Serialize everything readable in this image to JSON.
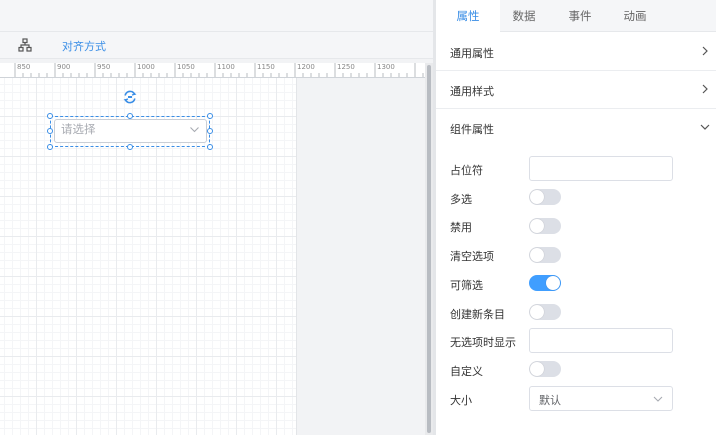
{
  "toolbar": {
    "tree_icon": "hierarchy-icon",
    "align_label": "对齐方式"
  },
  "ruler": {
    "labels": [
      "850",
      "900",
      "950",
      "1000",
      "1050",
      "1100",
      "1150",
      "1200",
      "1250",
      "1300"
    ]
  },
  "canvas_component": {
    "placeholder": "请选择",
    "rotate_icon": "rotate-icon",
    "chevron_icon": "chevron-down-icon"
  },
  "panel": {
    "tabs": [
      {
        "label": "属性",
        "active": true
      },
      {
        "label": "数据",
        "active": false
      },
      {
        "label": "事件",
        "active": false
      },
      {
        "label": "动画",
        "active": false
      }
    ],
    "sections": [
      {
        "title": "通用属性",
        "expanded": false
      },
      {
        "title": "通用样式",
        "expanded": false
      },
      {
        "title": "组件属性",
        "expanded": true
      }
    ],
    "props": {
      "placeholder": {
        "label": "占位符",
        "value": ""
      },
      "multiple": {
        "label": "多选",
        "on": false
      },
      "disabled": {
        "label": "禁用",
        "on": false
      },
      "clearable": {
        "label": "清空选项",
        "on": false
      },
      "filterable": {
        "label": "可筛选",
        "on": true
      },
      "allow_create": {
        "label": "创建新条目",
        "on": false
      },
      "no_data_text": {
        "label": "无选项时显示",
        "value": ""
      },
      "custom": {
        "label": "自定义",
        "on": false
      },
      "size": {
        "label": "大小",
        "value": "默认"
      }
    }
  },
  "colors": {
    "accent": "#409eff",
    "selection": "#3a8ee6"
  }
}
